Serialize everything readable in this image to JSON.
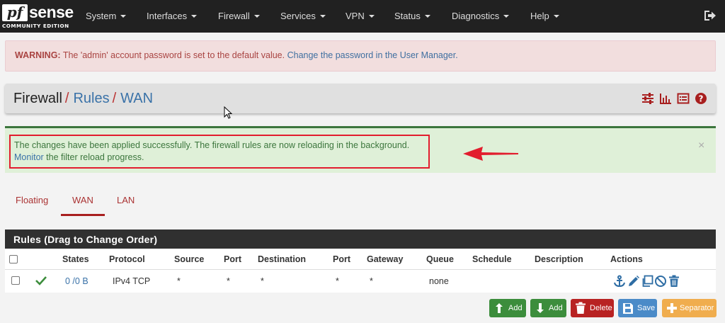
{
  "brand": {
    "pf": "pf",
    "sense": "sense",
    "edition": "COMMUNITY EDITION"
  },
  "nav": {
    "items": [
      {
        "label": "System"
      },
      {
        "label": "Interfaces"
      },
      {
        "label": "Firewall"
      },
      {
        "label": "Services"
      },
      {
        "label": "VPN"
      },
      {
        "label": "Status"
      },
      {
        "label": "Diagnostics"
      },
      {
        "label": "Help"
      }
    ],
    "logout_icon": "sign-out-icon"
  },
  "warning": {
    "strong": "WARNING:",
    "text": " The 'admin' account password is set to the default value. ",
    "link": "Change the password in the User Manager."
  },
  "breadcrumb": {
    "root": "Firewall",
    "sep1": "/",
    "second": "Rules",
    "sep2": "/",
    "third": "WAN",
    "icons": [
      "sliders-icon",
      "bar-chart-icon",
      "list-icon",
      "help-icon"
    ]
  },
  "success": {
    "line1": "The changes have been applied successfully. The firewall rules are now reloading in the background.",
    "link": "Monitor",
    "line2_rest": " the filter reload progress.",
    "close": "×"
  },
  "tabs": [
    {
      "label": "Floating",
      "active": false
    },
    {
      "label": "WAN",
      "active": true
    },
    {
      "label": "LAN",
      "active": false
    }
  ],
  "table": {
    "title": "Rules (Drag to Change Order)",
    "headers": {
      "states": "States",
      "protocol": "Protocol",
      "source": "Source",
      "port": "Port",
      "destination": "Destination",
      "dport": "Port",
      "gateway": "Gateway",
      "queue": "Queue",
      "schedule": "Schedule",
      "description": "Description",
      "actions": "Actions"
    },
    "rows": [
      {
        "enabled_icon": "check-icon",
        "states": "0 /0 B",
        "protocol": "IPv4 TCP",
        "source": "*",
        "port": "*",
        "destination": "*",
        "dport": "*",
        "gateway": "*",
        "queue": "none",
        "schedule": "",
        "description": "",
        "actions": [
          "anchor-icon",
          "pencil-icon",
          "copy-icon",
          "ban-icon",
          "trash-icon"
        ]
      }
    ]
  },
  "buttons": {
    "add_top": "Add",
    "add_bottom": "Add",
    "delete": "Delete",
    "save": "Save",
    "separator": "Separator"
  },
  "colors": {
    "navbar": "#212121",
    "warning_bg": "#f2dede",
    "success_bg": "#dff0d8",
    "accent_red": "#a81f1f",
    "link_blue": "#3a72a8",
    "highlight_box": "#e21d2e"
  }
}
